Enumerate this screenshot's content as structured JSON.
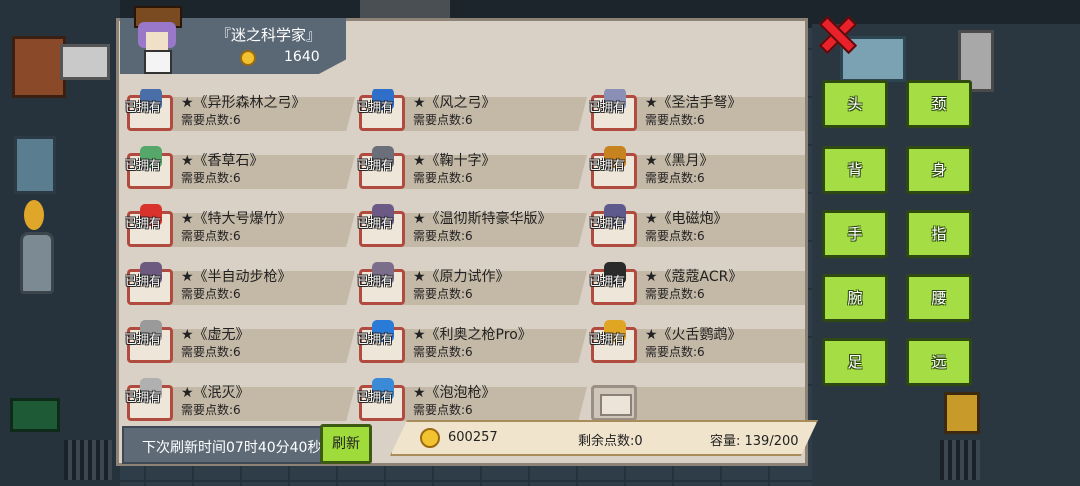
{
  "merchant": {
    "name": "『迷之科学家』",
    "coins": "1640"
  },
  "owned_label": "已拥有",
  "items": [
    {
      "name": "★《异形森林之弓》",
      "cost": "需要点数:6",
      "owned": true,
      "icon": "alien-bow-icon",
      "color": "#4a6fa8"
    },
    {
      "name": "★《风之弓》",
      "cost": "需要点数:6",
      "owned": true,
      "icon": "wind-bow-icon",
      "color": "#2f6fc9"
    },
    {
      "name": "★《圣洁手弩》",
      "cost": "需要点数:6",
      "owned": true,
      "icon": "holy-crossbow-icon",
      "color": "#8a8fb5"
    },
    {
      "name": "★《香草石》",
      "cost": "需要点数:6",
      "owned": true,
      "icon": "vanilla-stone-icon",
      "color": "#55a86a"
    },
    {
      "name": "★《鞠十字》",
      "cost": "需要点数:6",
      "owned": true,
      "icon": "cross-icon",
      "color": "#6a6f7a"
    },
    {
      "name": "★《黑月》",
      "cost": "需要点数:6",
      "owned": true,
      "icon": "black-moon-icon",
      "color": "#c7831f"
    },
    {
      "name": "★《特大号爆竹》",
      "cost": "需要点数:6",
      "owned": true,
      "icon": "firecracker-icon",
      "color": "#d8322a"
    },
    {
      "name": "★《温彻斯特豪华版》",
      "cost": "需要点数:6",
      "owned": true,
      "icon": "winchester-icon",
      "color": "#6b5a86"
    },
    {
      "name": "★《电磁炮》",
      "cost": "需要点数:6",
      "owned": true,
      "icon": "railgun-icon",
      "color": "#5e5a8e"
    },
    {
      "name": "★《半自动步枪》",
      "cost": "需要点数:6",
      "owned": true,
      "icon": "semi-auto-rifle-icon",
      "color": "#6c5a80"
    },
    {
      "name": "★《原力试作》",
      "cost": "需要点数:6",
      "owned": true,
      "icon": "force-prototype-icon",
      "color": "#7a6e8a"
    },
    {
      "name": "★《蔻蔻ACR》",
      "cost": "需要点数:6",
      "owned": true,
      "icon": "acr-rifle-icon",
      "color": "#2a2a2a"
    },
    {
      "name": "★《虚无》",
      "cost": "需要点数:6",
      "owned": true,
      "icon": "void-gun-icon",
      "color": "#9a9a9a"
    },
    {
      "name": "★《利奥之枪Pro》",
      "cost": "需要点数:6",
      "owned": true,
      "icon": "leo-gun-icon",
      "color": "#2a7ad8"
    },
    {
      "name": "★《火舌鹦鹉》",
      "cost": "需要点数:6",
      "owned": true,
      "icon": "fire-parrot-icon",
      "color": "#e0a522"
    },
    {
      "name": "★《泯灭》",
      "cost": "需要点数:6",
      "owned": true,
      "icon": "annihilation-gun-icon",
      "color": "#b0b0b0"
    },
    {
      "name": "★《泡泡枪》",
      "cost": "需要点数:6",
      "owned": true,
      "icon": "bubble-gun-icon",
      "color": "#3a8ad8"
    },
    {
      "name": "",
      "cost": "",
      "owned": false,
      "icon": "empty-slot-icon",
      "color": ""
    }
  ],
  "footer": {
    "refresh_timer": "下次刷新时间07时40分40秒",
    "refresh_button": "刷新",
    "gold": "600257",
    "remaining_points": "剩余点数:0",
    "capacity": "容量: 139/200"
  },
  "equip_slots": [
    "头",
    "颈",
    "背",
    "身",
    "手",
    "指",
    "腕",
    "腰",
    "足",
    "远"
  ],
  "colors": {
    "slot_green": "#a4dd44",
    "close_red": "#e8212a",
    "thumb_border": "#b24b3f",
    "panel": "#d9d1c6"
  }
}
